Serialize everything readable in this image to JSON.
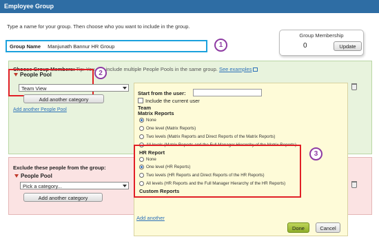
{
  "window": {
    "title": "Employee Group"
  },
  "intro_text": "Type a name for your group. Then choose who you want to include in the group.",
  "group_name": {
    "label": "Group Name",
    "value": "Manjunath Bannur HR Group"
  },
  "callouts": {
    "one": "1",
    "two": "2",
    "three": "3"
  },
  "membership": {
    "title": "Group Membership",
    "count": "0",
    "update_label": "Update"
  },
  "members": {
    "heading": "Choose Group Members:",
    "tip_prefix": "Tip:",
    "tip_rest": "You can include multiple People Pools in the same group.",
    "see_examples": "See examples",
    "pool_label": "People Pool",
    "selected_category": "Team View",
    "add_category_label": "Add another category",
    "add_pool_link": "Add another People Pool"
  },
  "exclude": {
    "heading": "Exclude these people from the group:",
    "pool_label": "People Pool",
    "category_placeholder": "Pick a category...",
    "add_category_label": "Add another category"
  },
  "popup": {
    "start_label": "Start from the user:",
    "start_value": "",
    "include_current": "Include the current user",
    "team_label": "Team",
    "matrix_heading": "Matrix Reports",
    "matrix_options": [
      "None",
      "One level (Matrix Reports)",
      "Two levels (Matrix Reports and Direct Reports of the Matrix Reports)",
      "All levels (Matrix Reports and the Full Manager Hierarchy of the Matrix Reports)"
    ],
    "matrix_selected": 0,
    "hr_heading": "HR Report",
    "hr_options": [
      "None",
      "One level (HR Reports)",
      "Two levels (HR Reports and Direct Reports of the HR Reports)",
      "All levels (HR Reports and the Full Manager Hierarchy of the HR Reports)"
    ],
    "hr_selected": 1,
    "custom_heading": "Custom Reports",
    "add_another": "Add another",
    "done_label": "Done",
    "cancel_label": "Cancel"
  },
  "colors": {
    "title_bar": "#2e6da4",
    "callout_purple": "#8e3ba3",
    "highlight_red": "#e11f26",
    "highlight_blue": "#1ba1dd",
    "members_bg": "#e8f3dd",
    "exclude_bg": "#fbe3e3",
    "popup_bg": "#fefbd8"
  }
}
